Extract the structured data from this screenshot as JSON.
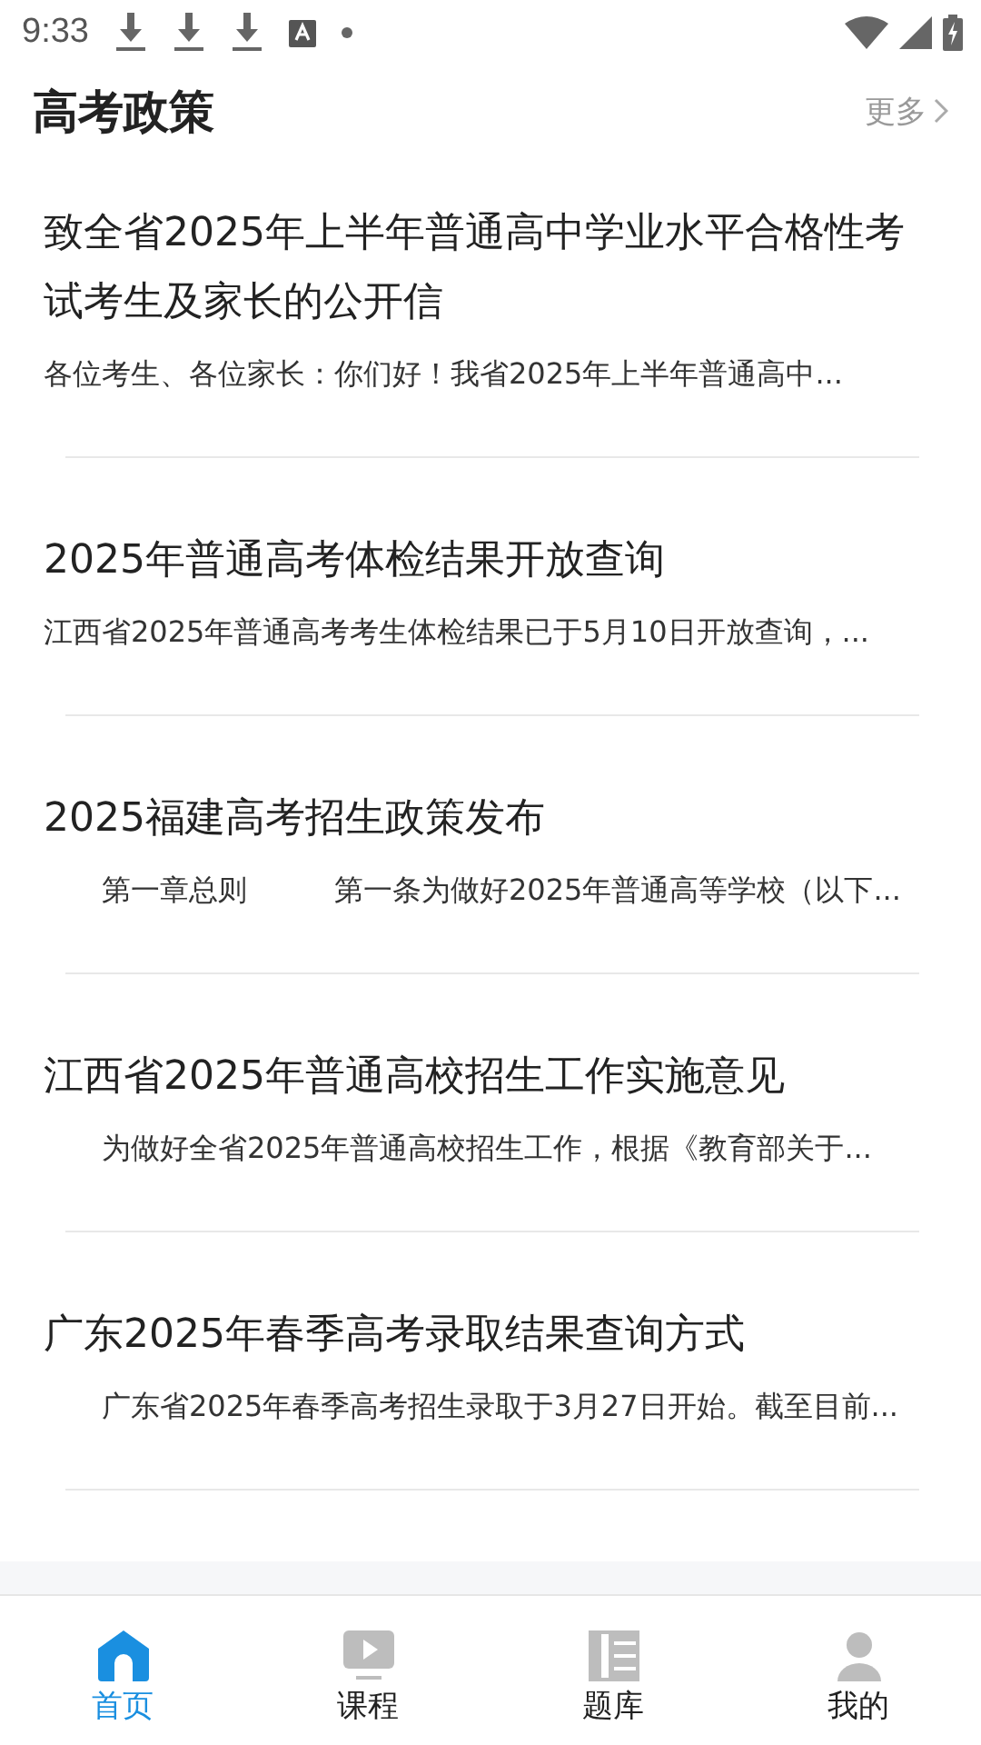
{
  "status_bar": {
    "time": "9:33"
  },
  "section": {
    "title": "高考政策",
    "more": "更多"
  },
  "articles": [
    {
      "title": "致全省2025年上半年普通高中学业水平合格性考试考生及家长的公开信",
      "summary": "各位考生、各位家长：你们好！我省2025年上半年普通高中..."
    },
    {
      "title": "2025年普通高考体检结果开放查询",
      "summary": "江西省2025年普通高考考生体检结果已于5月10日开放查询，..."
    },
    {
      "title": "2025福建高考招生政策发布",
      "summary": "　　第一章总则　　　第一条为做好2025年普通高等学校（以下..."
    },
    {
      "title": "江西省2025年普通高校招生工作实施意见",
      "summary": "　　为做好全省2025年普通高校招生工作，根据《教育部关于..."
    },
    {
      "title": "广东2025年春季高考录取结果查询方式",
      "summary": "　　广东省2025年春季高考招生录取于3月27日开始。截至目前..."
    }
  ],
  "tabs": [
    {
      "label": "首页",
      "kind": "home",
      "selected": true
    },
    {
      "label": "课程",
      "kind": "course",
      "selected": false
    },
    {
      "label": "题库",
      "kind": "bank",
      "selected": false
    },
    {
      "label": "我的",
      "kind": "me",
      "selected": false
    }
  ]
}
